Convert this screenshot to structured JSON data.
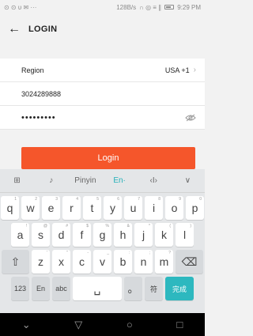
{
  "status_bar": {
    "left_icons": "⊙ ⊙ υ ✉ ···",
    "net_speed": "128B/s",
    "right_icons": "∩ ◎ ≡ ∥",
    "time": "9:29 PM"
  },
  "header": {
    "title": "LOGIN"
  },
  "form": {
    "region_label": "Region",
    "region_value": "USA +1",
    "phone_value": "3024289888",
    "password_mask": "•••••••••"
  },
  "login_button": "Login",
  "keyboard": {
    "toolbar": [
      "⊞",
      "♪",
      "Pinyin",
      "En·",
      "‹I›",
      "∨"
    ],
    "row1": [
      {
        "k": "q",
        "s": "1"
      },
      {
        "k": "w",
        "s": "2"
      },
      {
        "k": "e",
        "s": "3"
      },
      {
        "k": "r",
        "s": "4"
      },
      {
        "k": "t",
        "s": "5"
      },
      {
        "k": "y",
        "s": "6"
      },
      {
        "k": "u",
        "s": "7"
      },
      {
        "k": "i",
        "s": "8"
      },
      {
        "k": "o",
        "s": "9"
      },
      {
        "k": "p",
        "s": "0"
      }
    ],
    "row2": [
      {
        "k": "a",
        "s": "!"
      },
      {
        "k": "s",
        "s": "@"
      },
      {
        "k": "d",
        "s": "#"
      },
      {
        "k": "f",
        "s": "$"
      },
      {
        "k": "g",
        "s": "%"
      },
      {
        "k": "h",
        "s": "&"
      },
      {
        "k": "j",
        "s": "*"
      },
      {
        "k": "k",
        "s": "("
      },
      {
        "k": "l",
        "s": ")"
      }
    ],
    "row3": [
      {
        "k": "z",
        "s": "'"
      },
      {
        "k": "x",
        "s": "\""
      },
      {
        "k": "c",
        "s": "-"
      },
      {
        "k": "v",
        "s": "_"
      },
      {
        "k": "b",
        "s": ":"
      },
      {
        "k": "n",
        "s": ";"
      },
      {
        "k": "m",
        "s": "?"
      }
    ],
    "shift": "⇧",
    "backspace": "⌫",
    "num_key": "123",
    "lang_key": "En",
    "abc_key": "abc",
    "space_key": "␣",
    "punct_key": "。",
    "fu_key": "符",
    "done_key": "完成"
  },
  "navbar": {
    "down": "⌄",
    "back": "▽",
    "home": "○",
    "recent": "□"
  }
}
